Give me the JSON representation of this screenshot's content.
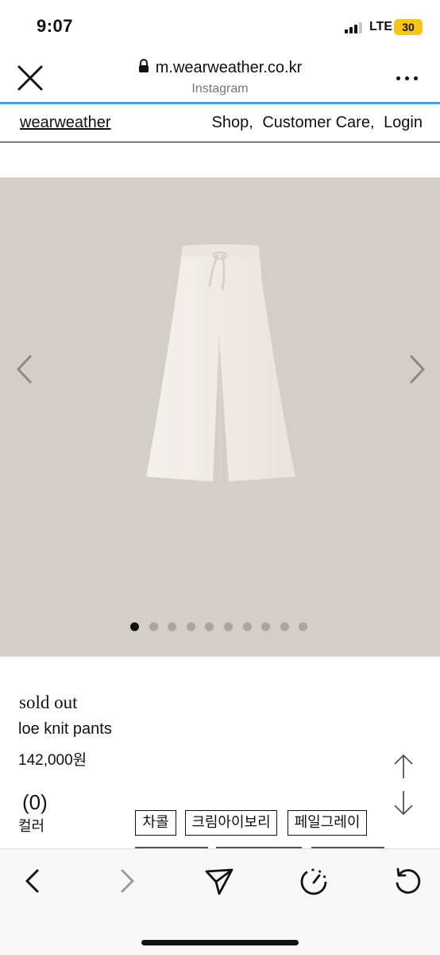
{
  "status_bar": {
    "time": "9:07",
    "network": "LTE",
    "battery": "30",
    "battery_color": "#f5c518"
  },
  "browser": {
    "url": "m.wearweather.co.kr",
    "source": "Instagram",
    "close_icon": "close-icon",
    "lock_icon": "lock-icon",
    "more_icon": "more-icon",
    "progress_color": "#4aa3e6",
    "progress": 1.0
  },
  "site_nav": {
    "brand": "wearweather",
    "links": [
      "Shop,",
      "Customer Care,",
      "Login"
    ]
  },
  "gallery": {
    "background": "#d4cfc6",
    "image": "knit-pants-photo",
    "prev_icon": "chevron-left-icon",
    "next_icon": "chevron-right-icon",
    "dot_count": 10,
    "active_dot": 1
  },
  "product": {
    "status": "sold out",
    "name": "loe knit pants",
    "price": "142,000원",
    "review_count": "(0)",
    "color_label": "컬러",
    "color_options": [
      "차콜",
      "크림아이보리",
      "페일그레이"
    ]
  },
  "scroll_controls": {
    "up_icon": "arrow-up-icon",
    "down_icon": "arrow-down-icon"
  },
  "toolbar": {
    "icons": [
      "back-icon",
      "forward-icon",
      "share-icon",
      "speed-icon",
      "reload-icon"
    ]
  }
}
